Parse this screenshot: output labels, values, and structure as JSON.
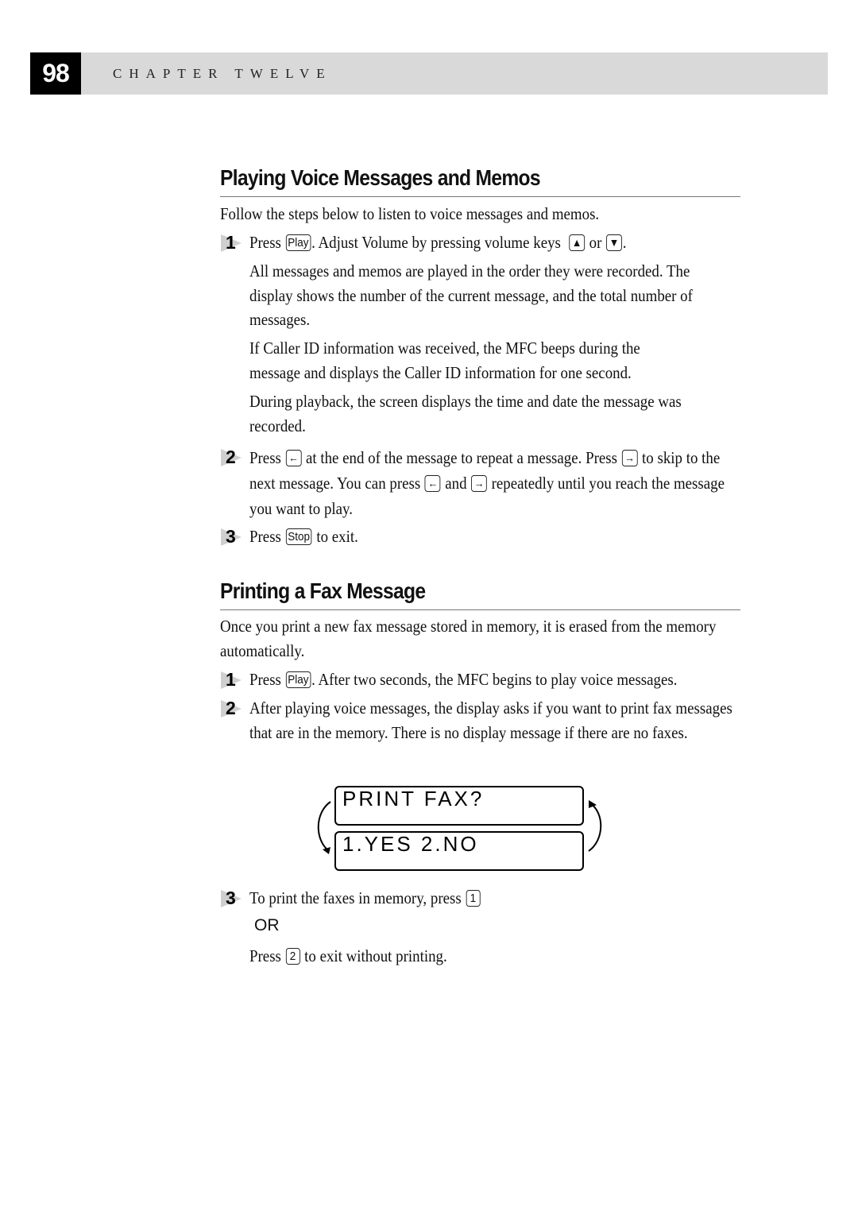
{
  "header": {
    "page_number": "98",
    "chapter": "CHAPTER TWELVE"
  },
  "sections": [
    {
      "title": "Playing Voice Messages and Memos",
      "intro": "Follow the steps below to listen to voice messages and memos.",
      "steps": [
        {
          "number": "1",
          "text_before_key": "Press",
          "key": "Play",
          "text_after_key": ". Adjust Volume by pressing volume keys",
          "keys_volume": [
            "up-arrow",
            "down-arrow"
          ],
          "or_word": "or",
          "end": ".",
          "notes": [
            "All messages and memos are played in the order they were recorded. The display shows the number of the current message, and the total number of messages.",
            "If Caller ID information was received, the MFC beeps during the message and displays the Caller ID information for one second.",
            "During playback, the screen displays the time and date the message was recorded."
          ]
        },
        {
          "number": "2",
          "parts": [
            "Press",
            "at the end of the message to repeat a message. Press",
            "to skip to the next message. You can press",
            "and",
            "repeatedly until you reach the message you want to play."
          ]
        },
        {
          "number": "3",
          "text_before_key": "Press",
          "key": "Stop",
          "text_after_key": "to exit."
        }
      ]
    },
    {
      "title": "Printing a Fax Message",
      "intro": "Once you print a new fax message stored in memory, it is erased from the memory automatically.",
      "steps": [
        {
          "number": "1",
          "text_before_key": "Press",
          "key": "Play",
          "text_after_key": ". After two seconds, the MFC begins to play voice messages."
        },
        {
          "number": "2",
          "text": "After playing voice messages, the display asks if you want to print fax messages that are in the memory. There is no display message if there are no faxes."
        },
        {
          "number": "3",
          "text_before_key": "To print the faxes in memory, press",
          "key": "1",
          "or_label": "OR",
          "alt_before_key": "Press",
          "alt_key": "2",
          "alt_after_key": "to exit without printing."
        }
      ]
    }
  ],
  "lcd_display": {
    "line1": "PRINT FAX?",
    "line2": "1.YES 2.NO"
  },
  "icons": {
    "left_arrow_key": "←",
    "right_arrow_key": "→",
    "up_key": "▲",
    "down_key": "▼"
  }
}
